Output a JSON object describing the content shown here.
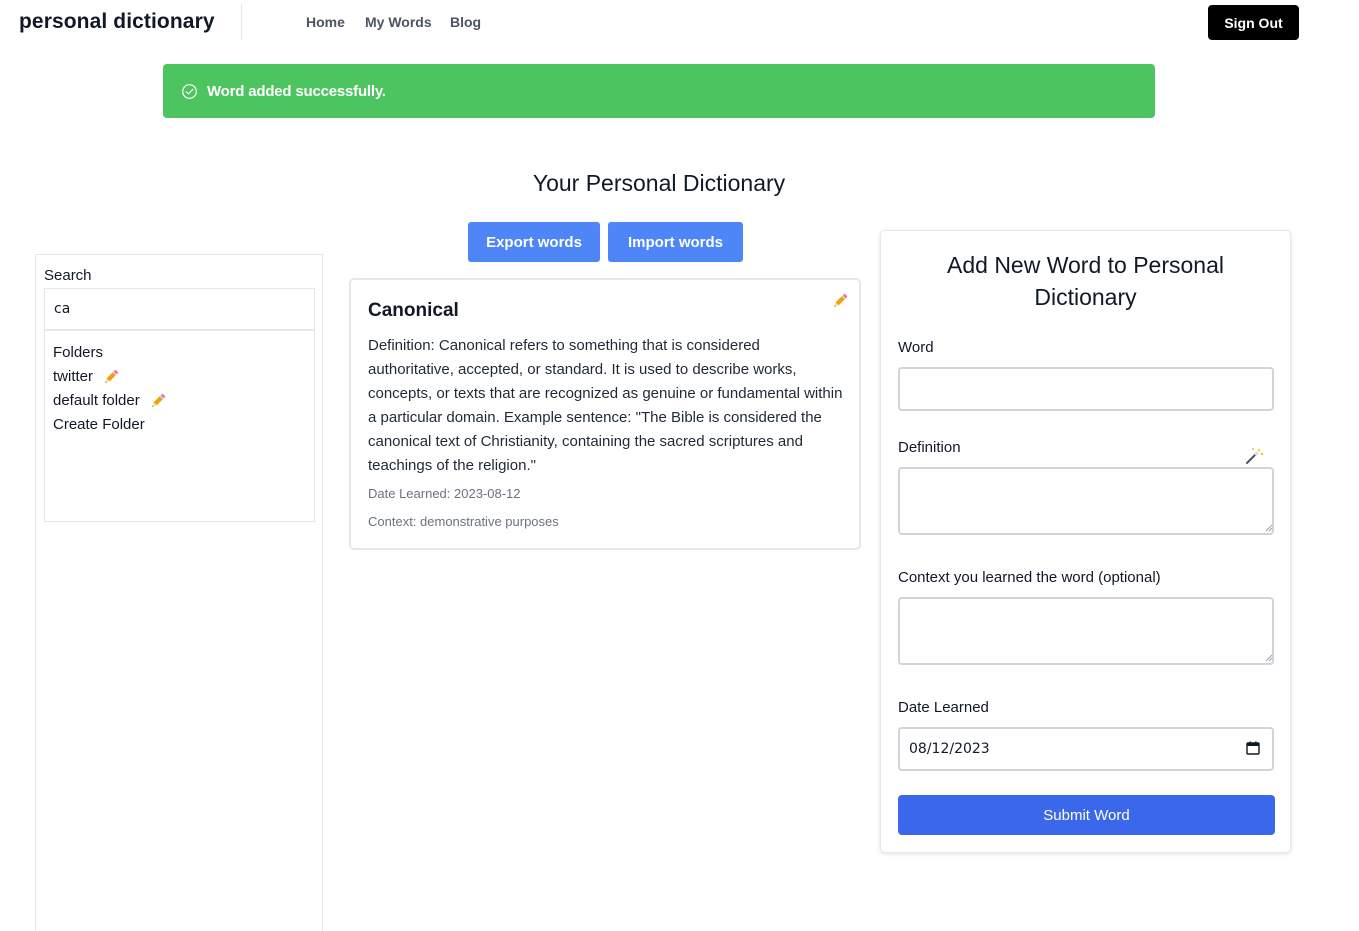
{
  "nav": {
    "brand": "personal dictionary",
    "links": [
      "Home",
      "My Words",
      "Blog"
    ],
    "sign_out": "Sign Out"
  },
  "alert": {
    "message": "Word added successfully.",
    "color": "#4cc45f"
  },
  "page": {
    "title": "Your Personal Dictionary",
    "export_label": "Export words",
    "import_label": "Import words"
  },
  "sidebar": {
    "search_label": "Search",
    "search_value": "ca",
    "folders_heading": "Folders",
    "folders": [
      "twitter",
      "default folder"
    ],
    "create_folder": "Create Folder"
  },
  "word": {
    "title": "Canonical",
    "definition": "Definition: Canonical refers to something that is considered authoritative, accepted, or standard. It is used to describe works, concepts, or texts that are recognized as genuine or fundamental within a particular domain. Example sentence: \"The Bible is considered the canonical text of Christianity, containing the sacred scriptures and teachings of the religion.\"",
    "date_learned": "Date Learned: 2023-08-12",
    "context": "Context: demonstrative purposes"
  },
  "form": {
    "title": "Add New Word to Personal Dictionary",
    "word_label": "Word",
    "definition_label": "Definition",
    "context_label": "Context you learned the word (optional)",
    "date_label": "Date Learned",
    "date_value": "08/12/2023",
    "submit_label": "Submit Word"
  },
  "colors": {
    "accent_blue": "#4f86f7",
    "submit_blue": "#3b68ea",
    "success_green": "#4cc45f"
  },
  "icons": {
    "alert": "check-circle-icon",
    "edit": "pencil-icon",
    "definition_helper": "magic-wand-icon",
    "date": "calendar-icon"
  }
}
